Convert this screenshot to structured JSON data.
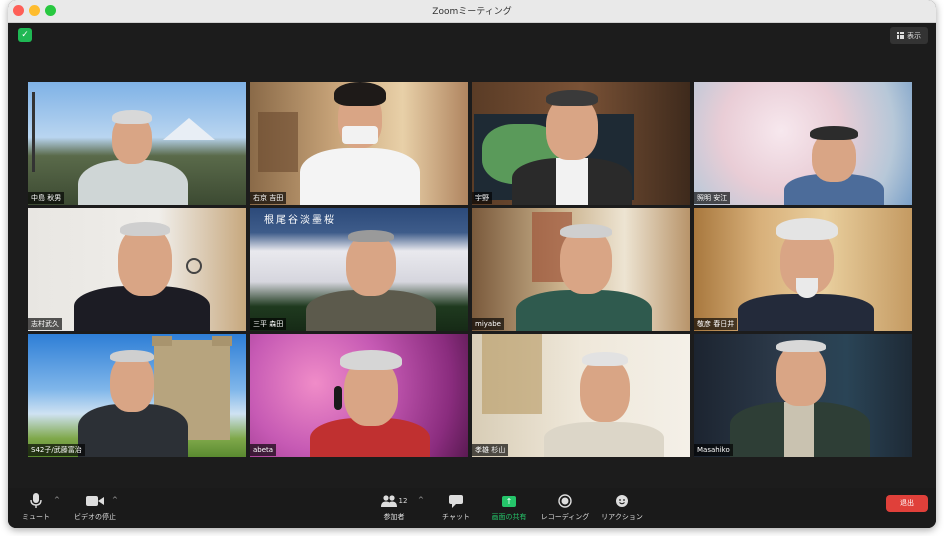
{
  "window": {
    "title": "Zoomミーティング"
  },
  "view_button": {
    "label": "表示"
  },
  "participants": [
    {
      "name": "中島 秋男"
    },
    {
      "name": "右京 吉田"
    },
    {
      "name": "宇野"
    },
    {
      "name": "照明 安江"
    },
    {
      "name": "志村武久"
    },
    {
      "name": "三平 森田",
      "background_text": "根尾谷淡墨桜"
    },
    {
      "name": "miyabe"
    },
    {
      "name": "敬彦 春日井"
    },
    {
      "name": "S42子/武藤富治",
      "active_speaker": true
    },
    {
      "name": "abeta"
    },
    {
      "name": "孝雄 杉山"
    },
    {
      "name": "Masahiko"
    }
  ],
  "toolbar": {
    "mute": {
      "label": "ミュート",
      "icon": "microphone-icon"
    },
    "video": {
      "label": "ビデオの停止",
      "icon": "video-camera-icon"
    },
    "participants": {
      "label": "参加者",
      "count": "12",
      "icon": "participants-icon"
    },
    "chat": {
      "label": "チャット",
      "icon": "chat-icon"
    },
    "share": {
      "label": "画面の共有",
      "icon": "share-screen-icon"
    },
    "record": {
      "label": "レコーディング",
      "icon": "record-icon"
    },
    "reaction": {
      "label": "リアクション",
      "icon": "reaction-icon"
    },
    "leave": {
      "label": "退出"
    }
  },
  "colors": {
    "accent_green": "#25c56a",
    "leave_red": "#e0403a",
    "active_border": "#f2e27a"
  }
}
